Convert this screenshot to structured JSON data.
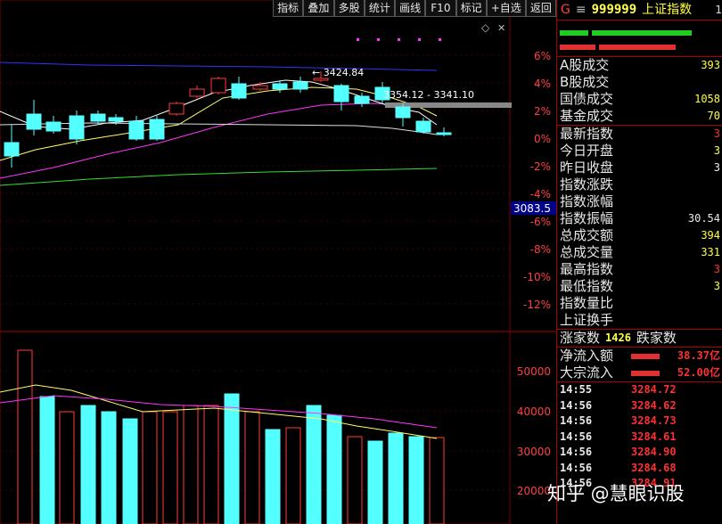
{
  "toolbar": [
    "指标",
    "叠加",
    "多股",
    "统计",
    "画线",
    "F10",
    "标记",
    "+自选",
    "返回"
  ],
  "chart": {
    "pct_labels": [
      "6%",
      "4%",
      "2%",
      "0%",
      "-2%",
      "-4%",
      "-6%",
      "-8%",
      "-10%",
      "-12%"
    ],
    "cursor_value": "3083.5",
    "high_annotation": "3424.84",
    "range_annotation": "3354.12 - 3341.10",
    "volume_labels": [
      "50000",
      "40000",
      "30000",
      "20000"
    ]
  },
  "panel": {
    "market_letter": "G",
    "menu_icon": "hamburger-icon",
    "code": "999999",
    "name": "上证指数",
    "top_right_digit": "1",
    "rows": [
      {
        "label": "A股成交",
        "value": "393",
        "color": "y"
      },
      {
        "label": "B股成交",
        "value": "",
        "color": "y"
      },
      {
        "label": "国债成交",
        "value": "1058",
        "color": "y"
      },
      {
        "label": "基金成交",
        "value": "70",
        "color": "y"
      },
      {
        "label": "最新指数",
        "value": "3",
        "color": "r"
      },
      {
        "label": "今日开盘",
        "value": "3",
        "color": "y"
      },
      {
        "label": "昨日收盘",
        "value": "3",
        "color": "w"
      },
      {
        "label": "指数涨跌",
        "value": "",
        "color": "w"
      },
      {
        "label": "指数涨幅",
        "value": "",
        "color": "w"
      },
      {
        "label": "指数振幅",
        "value": "30.54",
        "color": "w"
      },
      {
        "label": "总成交额",
        "value": "394",
        "color": "y"
      },
      {
        "label": "总成交量",
        "value": "331",
        "color": "y"
      },
      {
        "label": "最高指数",
        "value": "3",
        "color": "r"
      },
      {
        "label": "最低指数",
        "value": "3",
        "color": "y"
      },
      {
        "label": "指数量比",
        "value": "",
        "color": "w"
      },
      {
        "label": "上证换手",
        "value": "",
        "color": "w"
      }
    ],
    "breadth": {
      "up_label": "涨家数",
      "up_value": "1426",
      "down_label": "跌家数"
    },
    "flows": [
      {
        "label": "净流入额",
        "value": "38.37亿"
      },
      {
        "label": "大宗流入",
        "value": "52.00亿"
      }
    ],
    "ticks": [
      {
        "time": "14:55",
        "price": "3284.72"
      },
      {
        "time": "14:56",
        "price": "3284.62"
      },
      {
        "time": "14:56",
        "price": "3284.73"
      },
      {
        "time": "14:56",
        "price": "3284.61"
      },
      {
        "time": "14:56",
        "price": "3284.90"
      },
      {
        "time": "14:56",
        "price": "3284.68"
      },
      {
        "time": "14:56",
        "price": "3284.91"
      }
    ]
  },
  "watermark": "知乎 @慧眼识股",
  "colors": {
    "up": "#ff3b3b",
    "down": "#54ffff",
    "grid": "#7a0000",
    "ma5": "#ffffff",
    "ma10": "#ffff66",
    "ma20": "#ff33ff",
    "ma60": "#33dd33",
    "ma120": "#3333ff"
  }
}
